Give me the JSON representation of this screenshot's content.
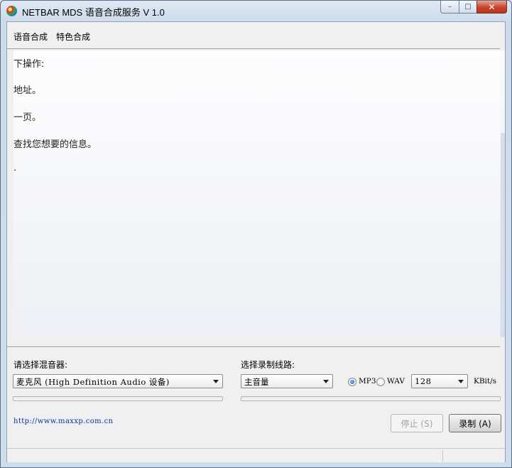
{
  "window": {
    "title": "NETBAR MDS 语音合成服务 V 1.0",
    "controls": {
      "minimize": "–",
      "maximize": "□",
      "close": "✕"
    }
  },
  "menu": {
    "items": [
      "语音合成",
      "特色合成"
    ]
  },
  "content": {
    "lines": [
      "下操作:",
      "地址。",
      "一页。",
      "查找您想要的信息。",
      "."
    ]
  },
  "mixer": {
    "label": "请选择混音器:",
    "selected": "麦克风 (High Definition Audio 设备)"
  },
  "recline": {
    "label": "选择录制线路:",
    "selected": "主音量"
  },
  "format": {
    "options": [
      {
        "label": "MP3",
        "checked": true
      },
      {
        "label": "WAV",
        "checked": false
      }
    ]
  },
  "bitrate": {
    "selected": "128",
    "unit": "KBit/s"
  },
  "footer": {
    "link": "http://www.maxxp.com.cn"
  },
  "buttons": {
    "stop": "停止 (S)",
    "record": "录制 (A)"
  },
  "progress": {
    "mixer_level": 0,
    "line_level": 0
  }
}
